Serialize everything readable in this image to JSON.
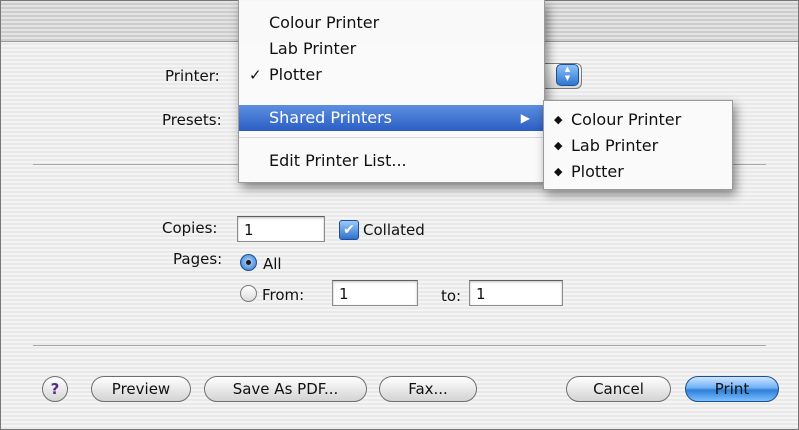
{
  "dialog": {
    "title_ghost": "·········· (( ·",
    "printer_label": "Printer:",
    "presets_label": "Presets:",
    "copies_label": "Copies:",
    "copies_value": "1",
    "collated_label": "Collated",
    "pages_label": "Pages:",
    "all_label": "All",
    "from_label": "From:",
    "from_value": "1",
    "to_label": "to:",
    "to_value": "1"
  },
  "menu": {
    "items": [
      {
        "label": "Colour Printer",
        "checked": false
      },
      {
        "label": "Lab Printer",
        "checked": false
      },
      {
        "label": "Plotter",
        "checked": true
      },
      {
        "label": "Shared Printers",
        "highlighted": true,
        "submenu": true
      },
      {
        "label": "Edit Printer List..."
      }
    ],
    "check_glyph": "✓",
    "arrow_glyph": "▶"
  },
  "submenu": {
    "items": [
      {
        "label": "Colour Printer"
      },
      {
        "label": "Lab Printer"
      },
      {
        "label": "Plotter"
      }
    ],
    "bullet_glyph": "◆"
  },
  "buttons": {
    "help": "?",
    "preview": "Preview",
    "save_pdf": "Save As PDF...",
    "fax": "Fax...",
    "cancel": "Cancel",
    "print": "Print"
  },
  "icons": {
    "help": "question-mark-icon",
    "stepper": "up-down-arrows-icon",
    "checkmark": "checkmark-icon",
    "submenu_arrow": "triangle-right-icon",
    "bullet": "diamond-bullet-icon"
  },
  "colors": {
    "accent": "#2a5ec4",
    "default_button": "#6fb0f5"
  }
}
